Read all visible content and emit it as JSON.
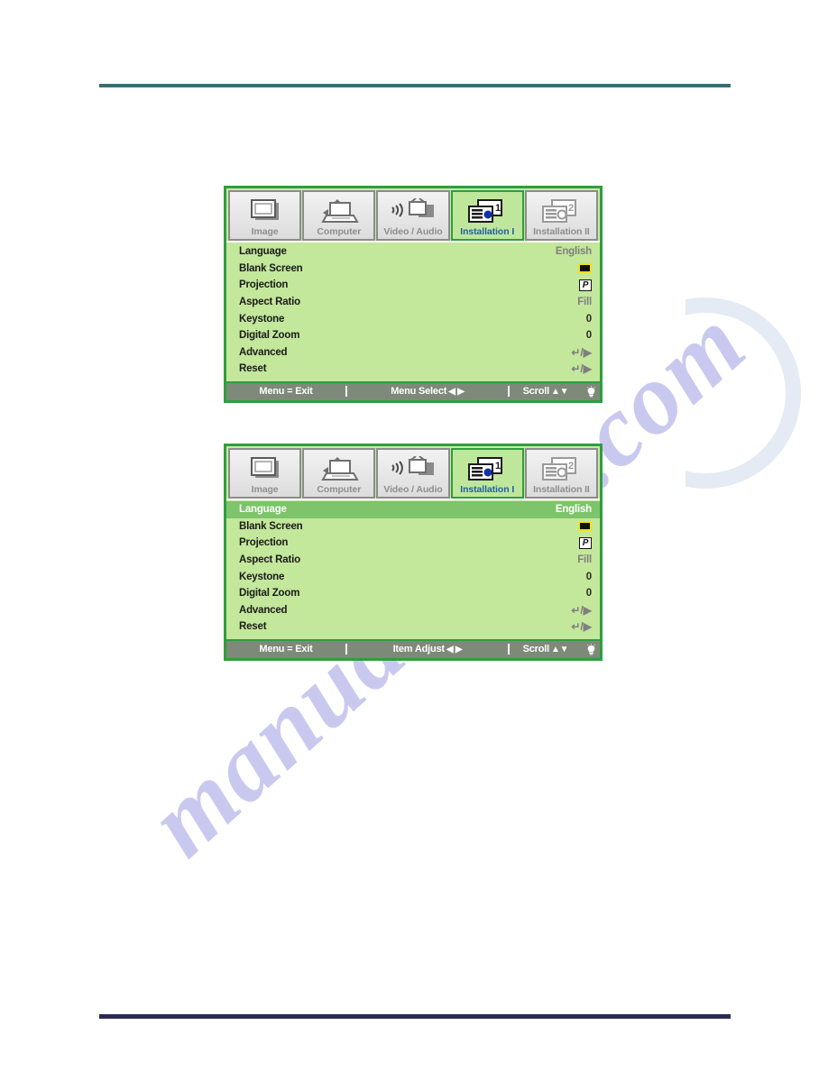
{
  "page": {
    "rule_top_color": "#3a6d73",
    "rule_bottom_color": "#2b2a55",
    "watermark": "manualshive.com"
  },
  "osd": {
    "tabs": [
      {
        "label": "Image",
        "icon": "screen-icon",
        "active": false
      },
      {
        "label": "Computer",
        "icon": "laptop-icon",
        "active": false
      },
      {
        "label": "Video / Audio",
        "icon": "video-audio-icon",
        "active": false
      },
      {
        "label": "Installation I",
        "icon": "installation1-icon",
        "active": true
      },
      {
        "label": "Installation II",
        "icon": "installation2-icon",
        "active": false
      }
    ],
    "items": [
      {
        "label": "Language",
        "value": "English",
        "value_type": "text"
      },
      {
        "label": "Blank Screen",
        "value": "",
        "value_type": "color-swatch"
      },
      {
        "label": "Projection",
        "value": "P",
        "value_type": "boxed-letter"
      },
      {
        "label": "Aspect Ratio",
        "value": "Fill",
        "value_type": "text"
      },
      {
        "label": "Keystone",
        "value": "0",
        "value_type": "text"
      },
      {
        "label": "Digital Zoom",
        "value": "0",
        "value_type": "text"
      },
      {
        "label": "Advanced",
        "value": "↵/▶",
        "value_type": "enter-arrow"
      },
      {
        "label": "Reset",
        "value": "↵/▶",
        "value_type": "enter-arrow"
      }
    ],
    "swatch_color": "#111111",
    "swatch_border_color": "#f2e21a",
    "accent_border_color": "#2f9e3f",
    "body_color": "#c3e79b",
    "selected_row_color": "#7dc46a",
    "status_bar_color": "#7e8a79"
  },
  "menu_one": {
    "selected_index": -1,
    "status": {
      "exit": "Menu = Exit",
      "middle": "Menu Select",
      "middle_arrows": "◀ ▶",
      "scroll": "Scroll",
      "scroll_arrows": "▲▼",
      "lamp": "lamp-icon"
    }
  },
  "menu_two": {
    "selected_index": 0,
    "status": {
      "exit": "Menu = Exit",
      "middle": "Item Adjust",
      "middle_arrows": "◀ ▶",
      "scroll": "Scroll",
      "scroll_arrows": "▲▼",
      "lamp": "lamp-icon"
    }
  }
}
